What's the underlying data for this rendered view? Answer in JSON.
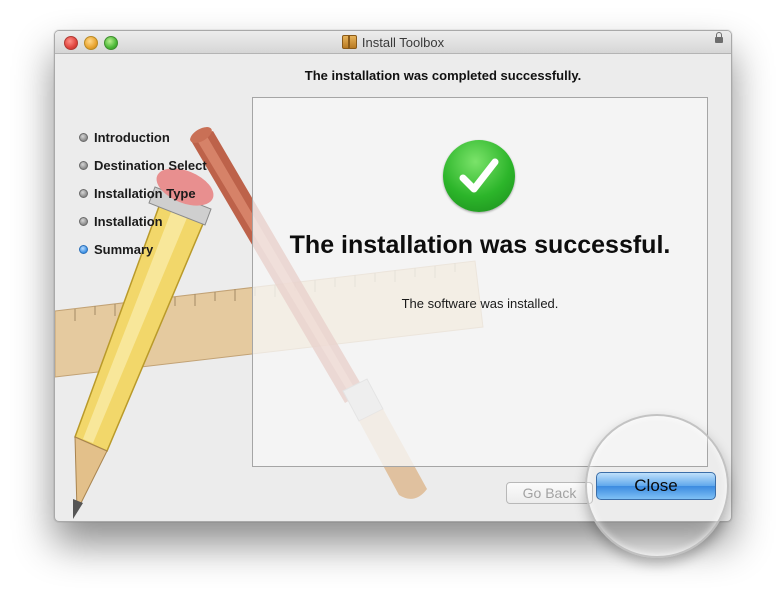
{
  "window": {
    "title": "Install Toolbox"
  },
  "heading": "The installation was completed successfully.",
  "steps": [
    {
      "label": "Introduction",
      "active": false
    },
    {
      "label": "Destination Select",
      "active": false
    },
    {
      "label": "Installation Type",
      "active": false
    },
    {
      "label": "Installation",
      "active": false
    },
    {
      "label": "Summary",
      "active": true
    }
  ],
  "result": {
    "title": "The installation was successful.",
    "message": "The software was installed."
  },
  "buttons": {
    "go_back": "Go Back",
    "close": "Close"
  },
  "icons": {
    "status": "checkmark-icon",
    "title": "package-icon",
    "lock": "lock-icon"
  },
  "colors": {
    "success_green": "#2cb52a",
    "default_button_blue": "#3b8be0",
    "active_step": "#3a8fe3"
  }
}
